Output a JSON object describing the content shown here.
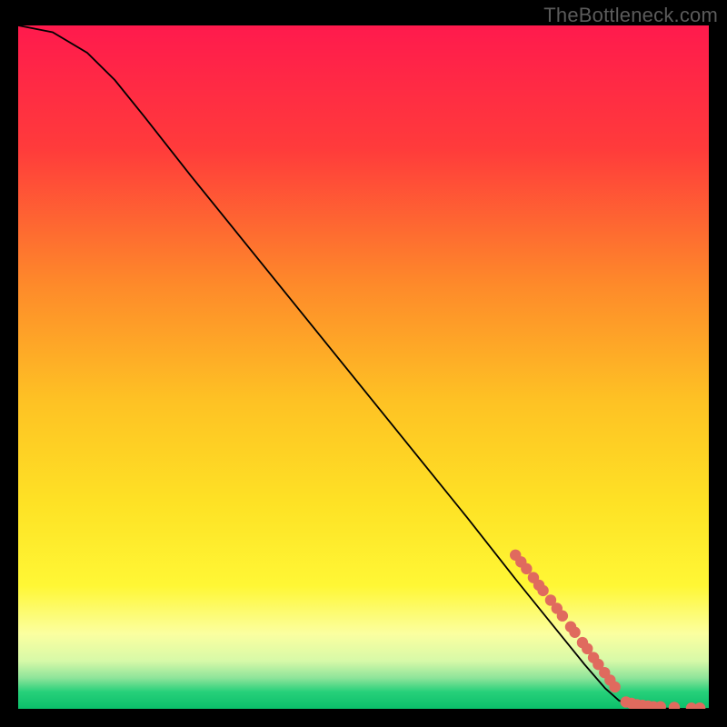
{
  "watermark": "TheBottleneck.com",
  "chart_data": {
    "type": "line",
    "title": "",
    "xlabel": "",
    "ylabel": "",
    "xlim": [
      0,
      100
    ],
    "ylim": [
      0,
      100
    ],
    "grid": false,
    "legend": false,
    "axes_visible": false,
    "curve": [
      {
        "x": 0,
        "y": 100
      },
      {
        "x": 5,
        "y": 99
      },
      {
        "x": 10,
        "y": 96
      },
      {
        "x": 14,
        "y": 92
      },
      {
        "x": 18,
        "y": 87
      },
      {
        "x": 25,
        "y": 78
      },
      {
        "x": 35,
        "y": 65.5
      },
      {
        "x": 45,
        "y": 53
      },
      {
        "x": 55,
        "y": 40.5
      },
      {
        "x": 65,
        "y": 28
      },
      {
        "x": 72,
        "y": 19
      },
      {
        "x": 78,
        "y": 11.5
      },
      {
        "x": 82,
        "y": 6.5
      },
      {
        "x": 85,
        "y": 3
      },
      {
        "x": 87,
        "y": 1.2
      },
      {
        "x": 89,
        "y": 0.4
      },
      {
        "x": 92,
        "y": 0.1
      },
      {
        "x": 96,
        "y": 0
      },
      {
        "x": 100,
        "y": 0
      }
    ],
    "marker_points_cluster_diagonal": [
      {
        "x": 72.0,
        "y": 22.5
      },
      {
        "x": 72.8,
        "y": 21.5
      },
      {
        "x": 73.6,
        "y": 20.5
      },
      {
        "x": 74.6,
        "y": 19.2
      },
      {
        "x": 75.4,
        "y": 18.1
      },
      {
        "x": 76.0,
        "y": 17.3
      },
      {
        "x": 77.1,
        "y": 15.9
      },
      {
        "x": 78.0,
        "y": 14.7
      },
      {
        "x": 78.8,
        "y": 13.6
      },
      {
        "x": 80.0,
        "y": 12.0
      },
      {
        "x": 80.6,
        "y": 11.2
      },
      {
        "x": 81.7,
        "y": 9.7
      },
      {
        "x": 82.4,
        "y": 8.8
      },
      {
        "x": 83.3,
        "y": 7.5
      },
      {
        "x": 84.0,
        "y": 6.5
      },
      {
        "x": 84.9,
        "y": 5.3
      },
      {
        "x": 85.7,
        "y": 4.2
      },
      {
        "x": 86.4,
        "y": 3.2
      }
    ],
    "marker_points_cluster_flat": [
      {
        "x": 88.0,
        "y": 1.0
      },
      {
        "x": 88.8,
        "y": 0.8
      },
      {
        "x": 89.6,
        "y": 0.6
      },
      {
        "x": 90.4,
        "y": 0.5
      },
      {
        "x": 91.2,
        "y": 0.4
      },
      {
        "x": 92.0,
        "y": 0.3
      },
      {
        "x": 93.0,
        "y": 0.3
      },
      {
        "x": 95.0,
        "y": 0.2
      },
      {
        "x": 97.5,
        "y": 0.1
      },
      {
        "x": 98.7,
        "y": 0.1
      }
    ],
    "marker_color": "#e06a5e",
    "curve_color": "#000000",
    "background_gradient": {
      "stops": [
        {
          "pos": 0.0,
          "color": "#ff1a4d"
        },
        {
          "pos": 0.18,
          "color": "#ff3b3b"
        },
        {
          "pos": 0.38,
          "color": "#fe8a2a"
        },
        {
          "pos": 0.55,
          "color": "#fec224"
        },
        {
          "pos": 0.7,
          "color": "#fee225"
        },
        {
          "pos": 0.82,
          "color": "#fff735"
        },
        {
          "pos": 0.89,
          "color": "#fbffa0"
        },
        {
          "pos": 0.93,
          "color": "#d7f9a8"
        },
        {
          "pos": 0.955,
          "color": "#8de49a"
        },
        {
          "pos": 0.975,
          "color": "#27d07a"
        },
        {
          "pos": 1.0,
          "color": "#0bbf6a"
        }
      ]
    }
  }
}
